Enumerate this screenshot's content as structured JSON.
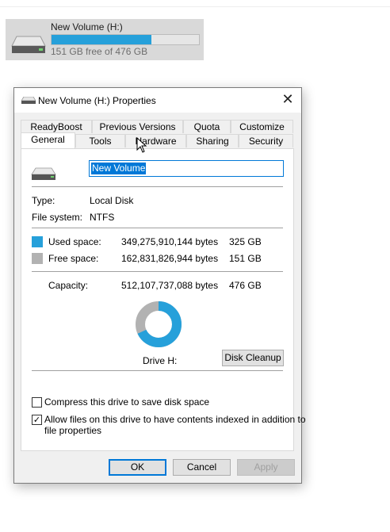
{
  "explorer": {
    "drive_name": "New Volume (H:)",
    "drive_free": "151 GB free of 476 GB",
    "used_fraction": 0.68,
    "bar_color": "#26a0da"
  },
  "dialog": {
    "title": "New Volume (H:) Properties",
    "close_label": "✕",
    "tabs_row1": [
      "ReadyBoost",
      "Previous Versions",
      "Quota",
      "Customize"
    ],
    "tabs_row2": [
      "General",
      "Tools",
      "Hardware",
      "Sharing",
      "Security"
    ],
    "active_tab": "General",
    "volume_name": "New Volume",
    "type_label": "Type:",
    "type_value": "Local Disk",
    "fs_label": "File system:",
    "fs_value": "NTFS",
    "used_label": "Used space:",
    "used_bytes": "349,275,910,144 bytes",
    "used_gb": "325 GB",
    "free_label": "Free space:",
    "free_bytes": "162,831,826,944 bytes",
    "free_gb": "151 GB",
    "capacity_label": "Capacity:",
    "capacity_bytes": "512,107,737,088 bytes",
    "capacity_gb": "476 GB",
    "drive_label": "Drive H:",
    "disk_cleanup": "Disk Cleanup",
    "compress_label": "Compress this drive to save disk space",
    "compress_checked": false,
    "index_label_line1": "Allow files on this drive to have contents indexed in addition to",
    "index_label_line2": "file properties",
    "index_checked": true,
    "used_color": "#26a0da",
    "free_color": "#b2b2b2",
    "used_fraction": 0.682
  },
  "footer": {
    "ok": "OK",
    "cancel": "Cancel",
    "apply": "Apply"
  }
}
